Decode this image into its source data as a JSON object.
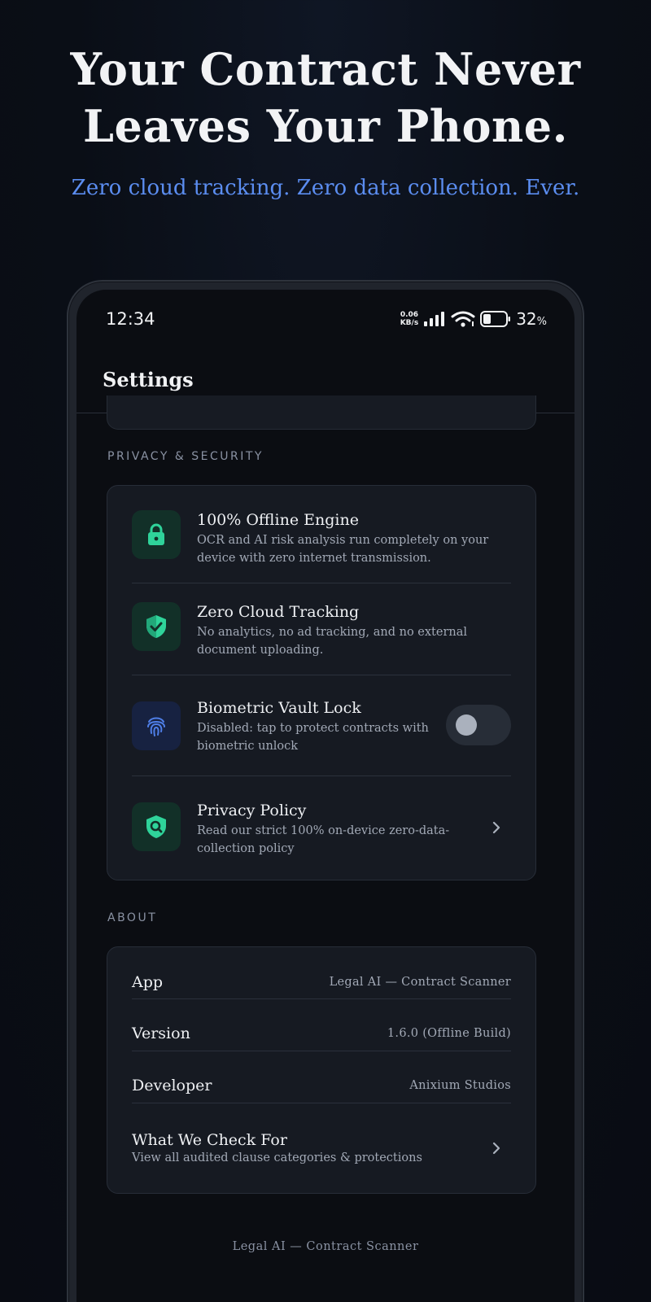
{
  "promo": {
    "headline_line1": "Your Contract Never",
    "headline_line2": "Leaves Your Phone.",
    "subhead": "Zero cloud tracking. Zero data collection. Ever."
  },
  "statusbar": {
    "time": "12:34",
    "net_speed_value": "0.06",
    "net_speed_unit": "KB/s",
    "battery_percent": "32",
    "battery_symbol": "%"
  },
  "appbar": {
    "title": "Settings"
  },
  "privacy": {
    "section_label": "PRIVACY & SECURITY",
    "items": [
      {
        "title": "100% Offline Engine",
        "desc": "OCR and AI risk analysis run completely on your device with zero internet transmission.",
        "icon": "lock-icon"
      },
      {
        "title": "Zero Cloud Tracking",
        "desc": "No analytics, no ad tracking, and no external document uploading.",
        "icon": "shield-check-icon"
      },
      {
        "title": "Biometric Vault Lock",
        "desc": "Disabled: tap to protect contracts with biometric unlock",
        "icon": "fingerprint-icon",
        "toggle_on": false
      },
      {
        "title": "Privacy Policy",
        "desc": "Read our strict 100% on-device zero-data-collection policy",
        "icon": "shield-search-icon"
      }
    ]
  },
  "about": {
    "section_label": "ABOUT",
    "rows": [
      {
        "label": "App",
        "value": "Legal AI — Contract Scanner"
      },
      {
        "label": "Version",
        "value": "1.6.0 (Offline Build)"
      },
      {
        "label": "Developer",
        "value": "Anixium Studios"
      }
    ],
    "check": {
      "title": "What We Check For",
      "desc": "View all audited clause categories & protections"
    }
  },
  "footer": {
    "text": "Legal AI — Contract Scanner"
  },
  "colors": {
    "accent_green": "#2fd39a",
    "accent_blue": "#5b8df0",
    "background": "#0a0e16"
  }
}
